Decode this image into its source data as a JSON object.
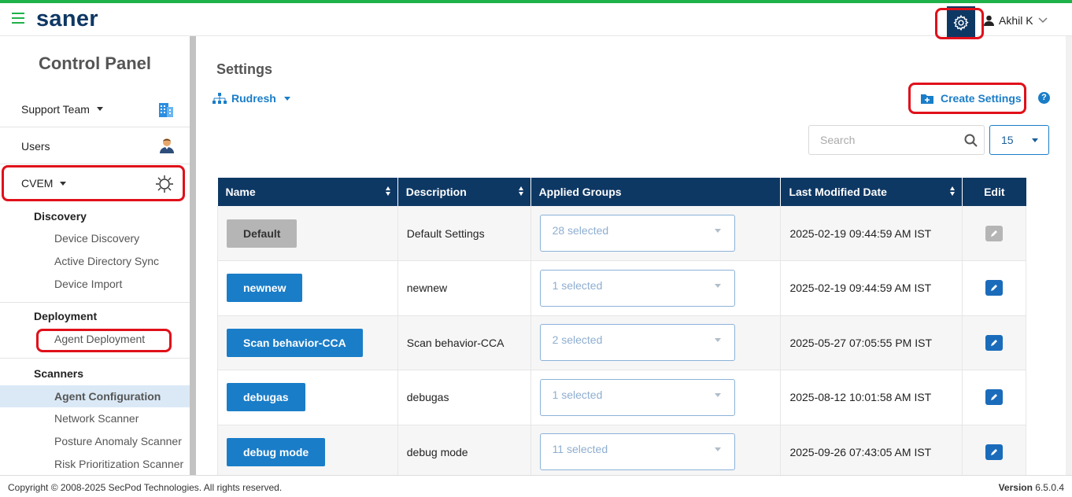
{
  "app": {
    "logo": "saner",
    "user_name": "Akhil K"
  },
  "sidebar": {
    "title": "Control Panel",
    "support_team": "Support Team",
    "users": "Users",
    "cvem": "CVEM",
    "discovery": {
      "heading": "Discovery",
      "items": [
        "Device Discovery",
        "Active Directory Sync",
        "Device Import"
      ]
    },
    "deployment": {
      "heading": "Deployment",
      "items": [
        "Agent Deployment"
      ]
    },
    "scanners": {
      "heading": "Scanners",
      "items": [
        "Agent Configuration",
        "Network Scanner",
        "Posture Anomaly Scanner",
        "Risk Prioritization Scanner"
      ]
    }
  },
  "main": {
    "title": "Settings",
    "org": "Rudresh",
    "create_label": "Create Settings",
    "help": "?",
    "search_placeholder": "Search",
    "page_size": "15"
  },
  "table": {
    "headers": [
      "Name",
      "Description",
      "Applied Groups",
      "Last Modified Date",
      "Edit"
    ],
    "rows": [
      {
        "name": "Default",
        "description": "Default Settings",
        "groups": "28 selected",
        "modified": "2025-02-19 09:44:59 AM IST"
      },
      {
        "name": "newnew",
        "description": "newnew",
        "groups": "1 selected",
        "modified": "2025-02-19 09:44:59 AM IST"
      },
      {
        "name": "Scan behavior-CCA",
        "description": "Scan behavior-CCA",
        "groups": "2 selected",
        "modified": "2025-05-27 07:05:55 PM IST"
      },
      {
        "name": "debugas",
        "description": "debugas",
        "groups": "1 selected",
        "modified": "2025-08-12 10:01:58 AM IST"
      },
      {
        "name": "debug mode",
        "description": "debug mode",
        "groups": "11 selected",
        "modified": "2025-09-26 07:43:05 AM IST"
      }
    ]
  },
  "footer": {
    "copyright": "Copyright © 2008-2025 SecPod Technologies. All rights reserved.",
    "version_label": "Version",
    "version": "6.5.0.4"
  },
  "colors": {
    "brand_navy": "#0e3864",
    "accent_blue": "#1a7dc8",
    "brand_green": "#1fb24a",
    "highlight_red": "#e0101a"
  }
}
